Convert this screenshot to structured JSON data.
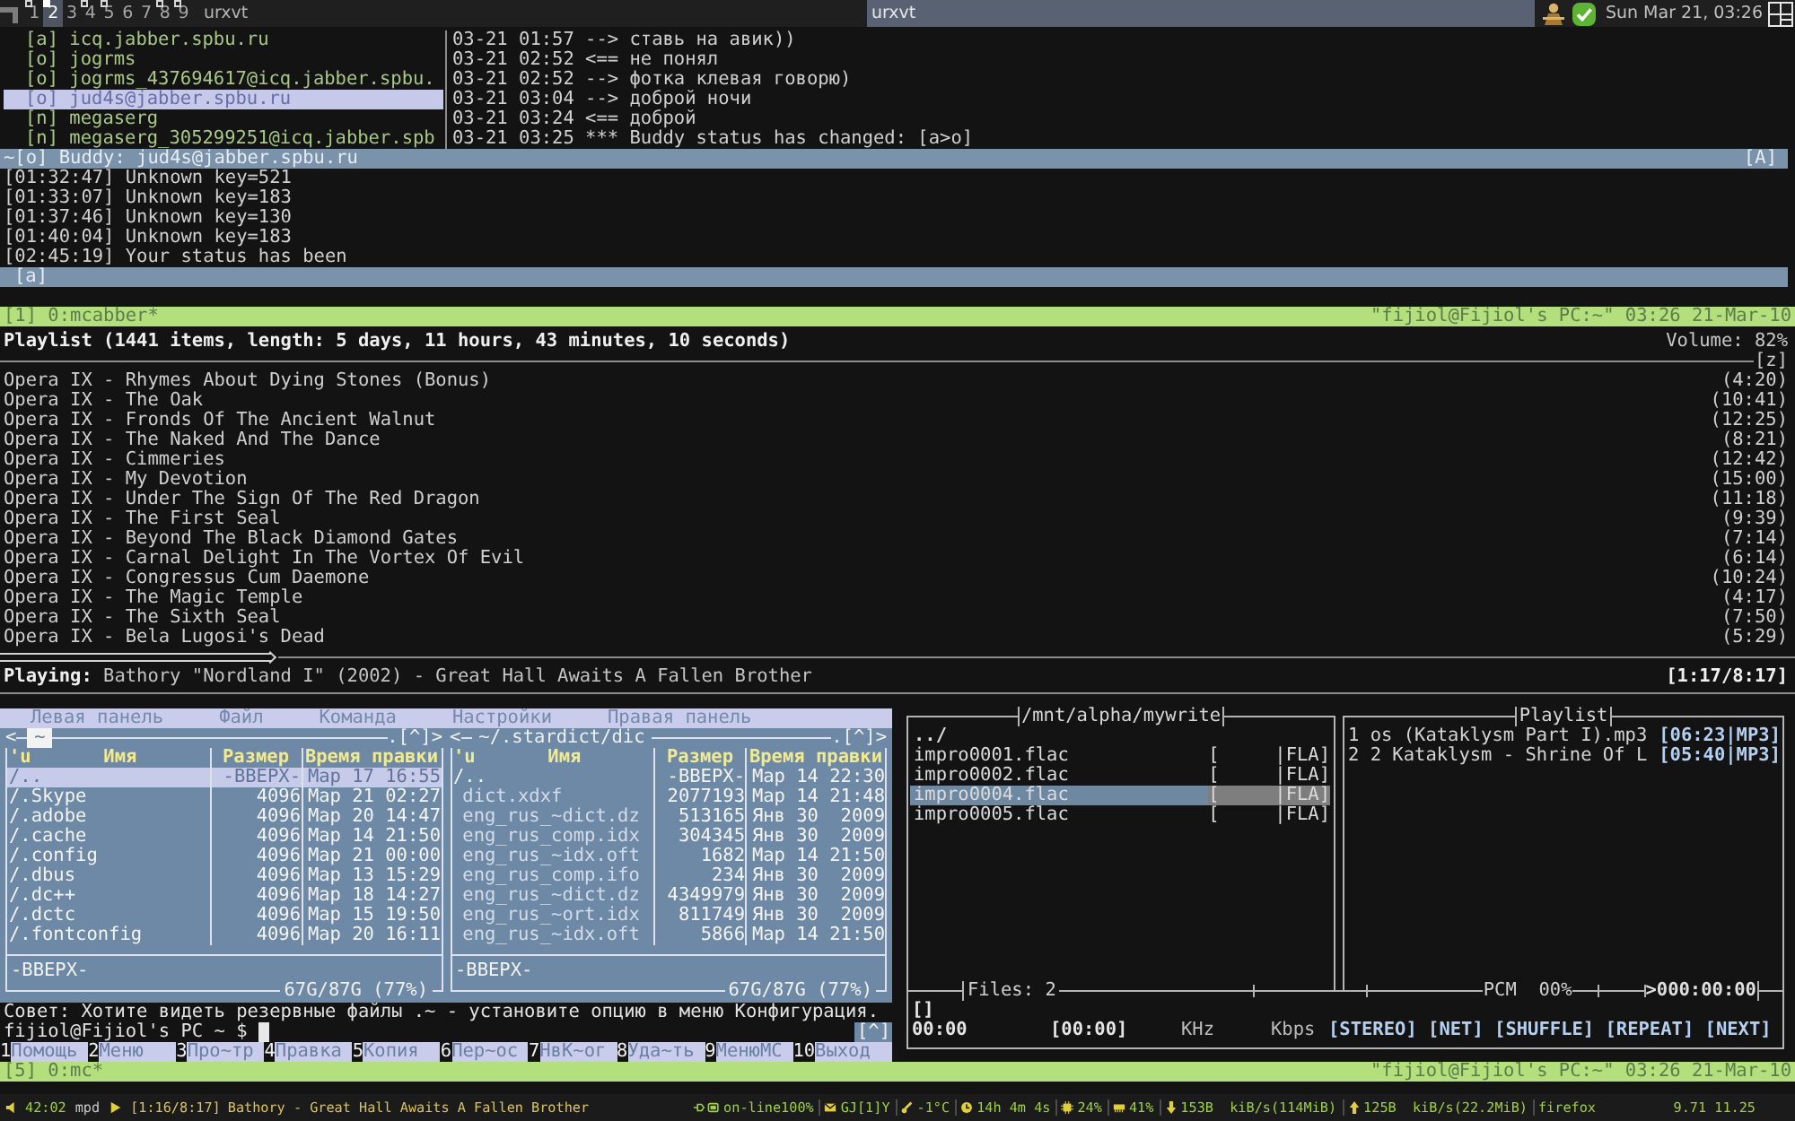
{
  "top_bar": {
    "tags": [
      {
        "label": "1",
        "selected": false,
        "occupied": true
      },
      {
        "label": "2",
        "selected": true,
        "occupied": true
      },
      {
        "label": "3",
        "selected": false,
        "occupied": false
      },
      {
        "label": "4",
        "selected": false,
        "occupied": true
      },
      {
        "label": "5",
        "selected": false,
        "occupied": true
      },
      {
        "label": "6",
        "selected": false,
        "occupied": false
      },
      {
        "label": "7",
        "selected": false,
        "occupied": false
      },
      {
        "label": "8",
        "selected": false,
        "occupied": true
      },
      {
        "label": "9",
        "selected": false,
        "occupied": true
      }
    ],
    "tasks": [
      {
        "title": "urxvt",
        "selected": false
      },
      {
        "title": "urxvt",
        "selected": true
      }
    ],
    "clock": "Sun Mar 21, 03:26"
  },
  "mcabber": {
    "roster": [
      {
        "text": "[a] icq.jabber.spbu.ru",
        "selected": false
      },
      {
        "text": "[o] jogrms",
        "selected": false
      },
      {
        "text": "[o] jogrms_437694617@icq.jabber.spbu.",
        "selected": false
      },
      {
        "text": "[o] jud4s@jabber.spbu.ru",
        "selected": true
      },
      {
        "text": "[n] megaserg",
        "selected": false
      },
      {
        "text": "[n] megaserg_305299251@icq.jabber.spb",
        "selected": false
      }
    ],
    "chat": [
      "03-21 01:57 --> ставь на авик))",
      "03-21 02:52 <== не понял",
      "03-21 02:52 --> фотка клевая говорю)",
      "03-21 03:04 --> доброй ночи",
      "03-21 03:24 <== доброй",
      "03-21 03:25 *** Buddy status has changed: [a>o]"
    ],
    "buddy_bar": {
      "text": "~[o] Buddy: jud4s@jabber.spbu.ru",
      "mode": "[A]"
    },
    "log": [
      "[01:32:47] Unknown key=521",
      "[01:33:07] Unknown key=183",
      "[01:37:46] Unknown key=130",
      "[01:40:04] Unknown key=183",
      "[02:45:19] Your status has been"
    ],
    "input_bar": "[a]",
    "screen_bar": {
      "window": "[1] 0:mcabber*",
      "info": "\"fijiol@Fijiol's PC:~\" 03:26 21-Mar-10"
    }
  },
  "ncmpcpp": {
    "header": "Playlist (1441 items, length: 5 days, 11 hours, 43 minutes, 10 seconds)",
    "volume": "Volume: 82%",
    "mode_flags": "[z]",
    "tracks": [
      {
        "title": "Opera IX - Rhymes About Dying Stones (Bonus)",
        "duration": "(4:20)"
      },
      {
        "title": "Opera IX - The Oak",
        "duration": "(10:41)"
      },
      {
        "title": "Opera IX - Fronds Of The Ancient Walnut",
        "duration": "(12:25)"
      },
      {
        "title": "Opera IX - The Naked And The Dance",
        "duration": "(8:21)"
      },
      {
        "title": "Opera IX - Cimmeries",
        "duration": "(12:42)"
      },
      {
        "title": "Opera IX - My Devotion",
        "duration": "(15:00)"
      },
      {
        "title": "Opera IX - Under The Sign Of The Red Dragon",
        "duration": "(11:18)"
      },
      {
        "title": "Opera IX - The First Seal",
        "duration": "(9:39)"
      },
      {
        "title": "Opera IX - Beyond The Black Diamond Gates",
        "duration": "(7:14)"
      },
      {
        "title": "Opera IX - Carnal Delight In The Vortex Of Evil",
        "duration": "(6:14)"
      },
      {
        "title": "Opera IX - Congressus Cum Daemone",
        "duration": "(10:24)"
      },
      {
        "title": "Opera IX - The Magic Temple",
        "duration": "(4:17)"
      },
      {
        "title": "Opera IX - The Sixth Seal",
        "duration": "(7:50)"
      },
      {
        "title": "Opera IX - Bela Lugosi's Dead",
        "duration": "(5:29)"
      }
    ],
    "progress": {
      "level": 0.155
    },
    "now_playing": {
      "label": "Playing:",
      "track": "Bathory \"Nordland I\" (2002) - Great Hall Awaits A Fallen Brother",
      "time": "[1:17/8:17]"
    }
  },
  "mc": {
    "menu": [
      "Левая панель",
      "Файл",
      "Команда",
      "Настройки",
      "Правая панель"
    ],
    "panels": [
      {
        "nav_left": "<",
        "path": "~",
        "active": true,
        "nav_right": ".[^]>",
        "sort_indicator": "'u",
        "columns": [
          "Имя",
          "Размер",
          "Время правки"
        ],
        "rows": [
          {
            "name": "/..",
            "size": "-ВВЕРХ-",
            "date": "Мар 17 16:55",
            "kind": "dir",
            "selected": true
          },
          {
            "name": "/.Skype",
            "size": "4096",
            "date": "Мар 21 02:27",
            "kind": "dir",
            "selected": false
          },
          {
            "name": "/.adobe",
            "size": "4096",
            "date": "Мар 20 14:47",
            "kind": "dir",
            "selected": false
          },
          {
            "name": "/.cache",
            "size": "4096",
            "date": "Мар 14 21:50",
            "kind": "dir",
            "selected": false
          },
          {
            "name": "/.config",
            "size": "4096",
            "date": "Мар 21 00:00",
            "kind": "dir",
            "selected": false
          },
          {
            "name": "/.dbus",
            "size": "4096",
            "date": "Мар 13 15:29",
            "kind": "dir",
            "selected": false
          },
          {
            "name": "/.dc++",
            "size": "4096",
            "date": "Мар 18 14:27",
            "kind": "dir",
            "selected": false
          },
          {
            "name": "/.dctc",
            "size": "4096",
            "date": "Мар 15 19:50",
            "kind": "dir",
            "selected": false
          },
          {
            "name": "/.fontconfig",
            "size": "4096",
            "date": "Мар 20 16:11",
            "kind": "dir",
            "selected": false
          }
        ],
        "mini_status": "-ВВЕРХ-",
        "disk": "67G/87G (77%)"
      },
      {
        "nav_left": "<",
        "path": "~/.stardict/dic",
        "active": false,
        "nav_right": ".[^]>",
        "sort_indicator": "'u",
        "columns": [
          "Имя",
          "Размер",
          "Время правки"
        ],
        "rows": [
          {
            "name": "/..",
            "size": "-ВВЕРХ-",
            "date": "Мар 14 22:30",
            "kind": "dir",
            "selected": false
          },
          {
            "name": "dict.xdxf",
            "size": "2077193",
            "date": "Мар 14 21:48",
            "kind": "file",
            "selected": false
          },
          {
            "name": "eng_rus_~dict.dz",
            "size": "513165",
            "date": "Янв 30  2009",
            "kind": "file",
            "selected": false
          },
          {
            "name": "eng_rus_comp.idx",
            "size": "304345",
            "date": "Янв 30  2009",
            "kind": "file",
            "selected": false
          },
          {
            "name": "eng_rus_~idx.oft",
            "size": "1682",
            "date": "Мар 14 21:50",
            "kind": "file",
            "selected": false
          },
          {
            "name": "eng_rus_comp.ifo",
            "size": "234",
            "date": "Янв 30  2009",
            "kind": "file",
            "selected": false
          },
          {
            "name": "eng_rus_~dict.dz",
            "size": "4349979",
            "date": "Янв 30  2009",
            "kind": "file",
            "selected": false
          },
          {
            "name": "eng_rus_~ort.idx",
            "size": "811749",
            "date": "Янв 30  2009",
            "kind": "file",
            "selected": false
          },
          {
            "name": "eng_rus_~idx.oft",
            "size": "5866",
            "date": "Мар 14 21:50",
            "kind": "file",
            "selected": false
          }
        ],
        "mini_status": "-ВВЕРХ-",
        "disk": "67G/87G (77%)"
      }
    ],
    "hint": "Совет: Хотите видеть резервные файлы .~ - установите опцию в меню Конфигурация.",
    "prompt": "fijiol@Fijiol's PC ~ $",
    "prompt_button": "[^]",
    "fkeys": [
      {
        "num": "1",
        "label": "Помощь"
      },
      {
        "num": "2",
        "label": "Меню"
      },
      {
        "num": "3",
        "label": "Про~тр"
      },
      {
        "num": "4",
        "label": "Правка"
      },
      {
        "num": "5",
        "label": "Копия"
      },
      {
        "num": "6",
        "label": "Пер~ос"
      },
      {
        "num": "7",
        "label": "НвК~ог"
      },
      {
        "num": "8",
        "label": "Уда~ть"
      },
      {
        "num": "9",
        "label": "МенюMC"
      },
      {
        "num": "10",
        "label": "Выход"
      }
    ]
  },
  "moc": {
    "browser": {
      "title": "/mnt/alpha/mywrite",
      "items": [
        {
          "name": "../",
          "kind": "dir",
          "selected": false
        },
        {
          "name": "impro0001.flac",
          "time": "[",
          "format": "|FLA]",
          "kind": "file",
          "selected": false
        },
        {
          "name": "impro0002.flac",
          "time": "[",
          "format": "|FLA]",
          "kind": "file",
          "selected": false
        },
        {
          "name": "impro0004.flac",
          "time": "[",
          "format": "|FLA]",
          "kind": "file",
          "selected": true
        },
        {
          "name": "impro0005.flac",
          "time": "[",
          "format": "|FLA]",
          "kind": "file",
          "selected": false
        }
      ]
    },
    "playlist": {
      "title": "Playlist",
      "items": [
        {
          "text": "1 os (Kataklysm Part I).mp3",
          "info": "[06:23|MP3]"
        },
        {
          "text": "2 2 Kataklysm - Shrine Of L",
          "info": "[05:40|MP3]"
        }
      ]
    },
    "files": "Files: 2",
    "mixer": "PCM  00%",
    "remaining": ">000:00:00",
    "title_line": "[]",
    "time": "00:00",
    "total": "[00:00]",
    "rate": "KHz",
    "bitrate": "Kbps",
    "flags": [
      "[STEREO]",
      "[NET]",
      "[SHUFFLE]",
      "[REPEAT]",
      "[NEXT]"
    ]
  },
  "bottom_screen_bar": {
    "window": "[5] 0:mc*",
    "info": "\"fijiol@Fijiol's PC:~\" 03:26 21-Mar-10"
  },
  "status_bar": {
    "mpd": {
      "time": "42:02",
      "label": "mpd",
      "position": "[1:16/8:17]",
      "track": "Bathory - Great Hall Awaits A Fallen Brother"
    },
    "widgets": [
      {
        "kind": "power",
        "text": "on-line100%"
      },
      {
        "kind": "mail",
        "text": "GJ[1]Y"
      },
      {
        "kind": "weather",
        "text": "-1°C"
      },
      {
        "kind": "uptime",
        "text": "14h 4m 4s"
      },
      {
        "kind": "cpu",
        "text": "24%"
      },
      {
        "kind": "memory",
        "text": "41%"
      },
      {
        "kind": "download",
        "text": "153B  kiB/s(114MiB)"
      },
      {
        "kind": "upload",
        "text": "125B  kiB/s(22.2MiB)"
      }
    ],
    "window": "firefox",
    "load": "9.71 11.25"
  }
}
